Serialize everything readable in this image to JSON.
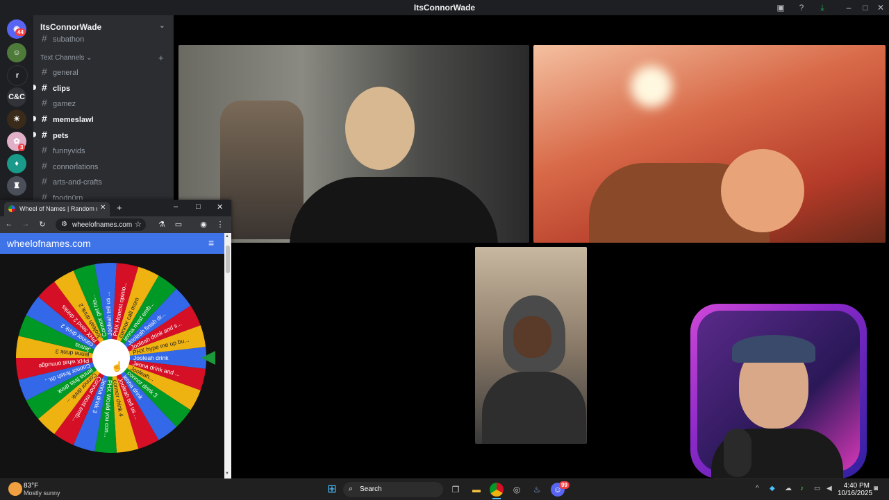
{
  "window": {
    "title": "ItsConnorWade"
  },
  "servers": [
    {
      "name": "discord-home",
      "badge": "44"
    },
    {
      "name": "avatar-server"
    },
    {
      "name": "r-server",
      "label": "r"
    },
    {
      "name": "cnc-server",
      "label": "C&C"
    },
    {
      "name": "server-5"
    },
    {
      "name": "server-6",
      "badge": "3"
    },
    {
      "name": "server-7"
    },
    {
      "name": "server-8"
    }
  ],
  "sidebar": {
    "server_name": "ItsConnorWade",
    "top_item": "subathon",
    "section_label": "Text Channels",
    "channels": [
      {
        "label": "general",
        "bold": false
      },
      {
        "label": "clips",
        "bold": true
      },
      {
        "label": "gamez",
        "bold": false
      },
      {
        "label": "memeslawl",
        "bold": true
      },
      {
        "label": "pets",
        "bold": true
      },
      {
        "label": "funnyvids",
        "bold": false
      },
      {
        "label": "connorlations",
        "bold": false
      },
      {
        "label": "arts-and-crafts",
        "bold": false
      },
      {
        "label": "foodn0rn",
        "bold": false
      }
    ]
  },
  "browser": {
    "tab_title": "Wheel of Names | Random nam",
    "url": "wheelofnames.com",
    "site_title": "wheelofnames.com"
  },
  "wheel": {
    "colors": [
      "#3369e8",
      "#d50f25",
      "#eeb211",
      "#009925"
    ],
    "segments": [
      "Jooleah drink",
      "Jenna drink and ...",
      "Jooleah...",
      "connor drink 3",
      "jenna drink",
      "Jooleah tell us ...",
      "connor drink 4",
      "PHX Would you con...",
      "Jenna drink 3",
      "Connor most emb...",
      "Connor drink ...",
      "jenna finis drink",
      "Connor finish dri...",
      "PHX what onnudge",
      "jenna drink 3",
      "Jenna",
      "connor drink 2",
      "PHX send 2 drinks",
      "Jooleah drink 2",
      "Connor get his...",
      "Jooleah tell us ...",
      "PHX Honest opinio...",
      "connor call mom",
      "jenna most emb...",
      "Jooleah finish dr...",
      "Jooleah drink and s...",
      "PHX hype me up bu..."
    ]
  },
  "taskbar": {
    "weather_temp": "83°F",
    "weather_desc": "Mostly sunny",
    "search": "Search",
    "time": "4:40 PM",
    "date": "10/16/2025",
    "discord_badge": "99"
  }
}
